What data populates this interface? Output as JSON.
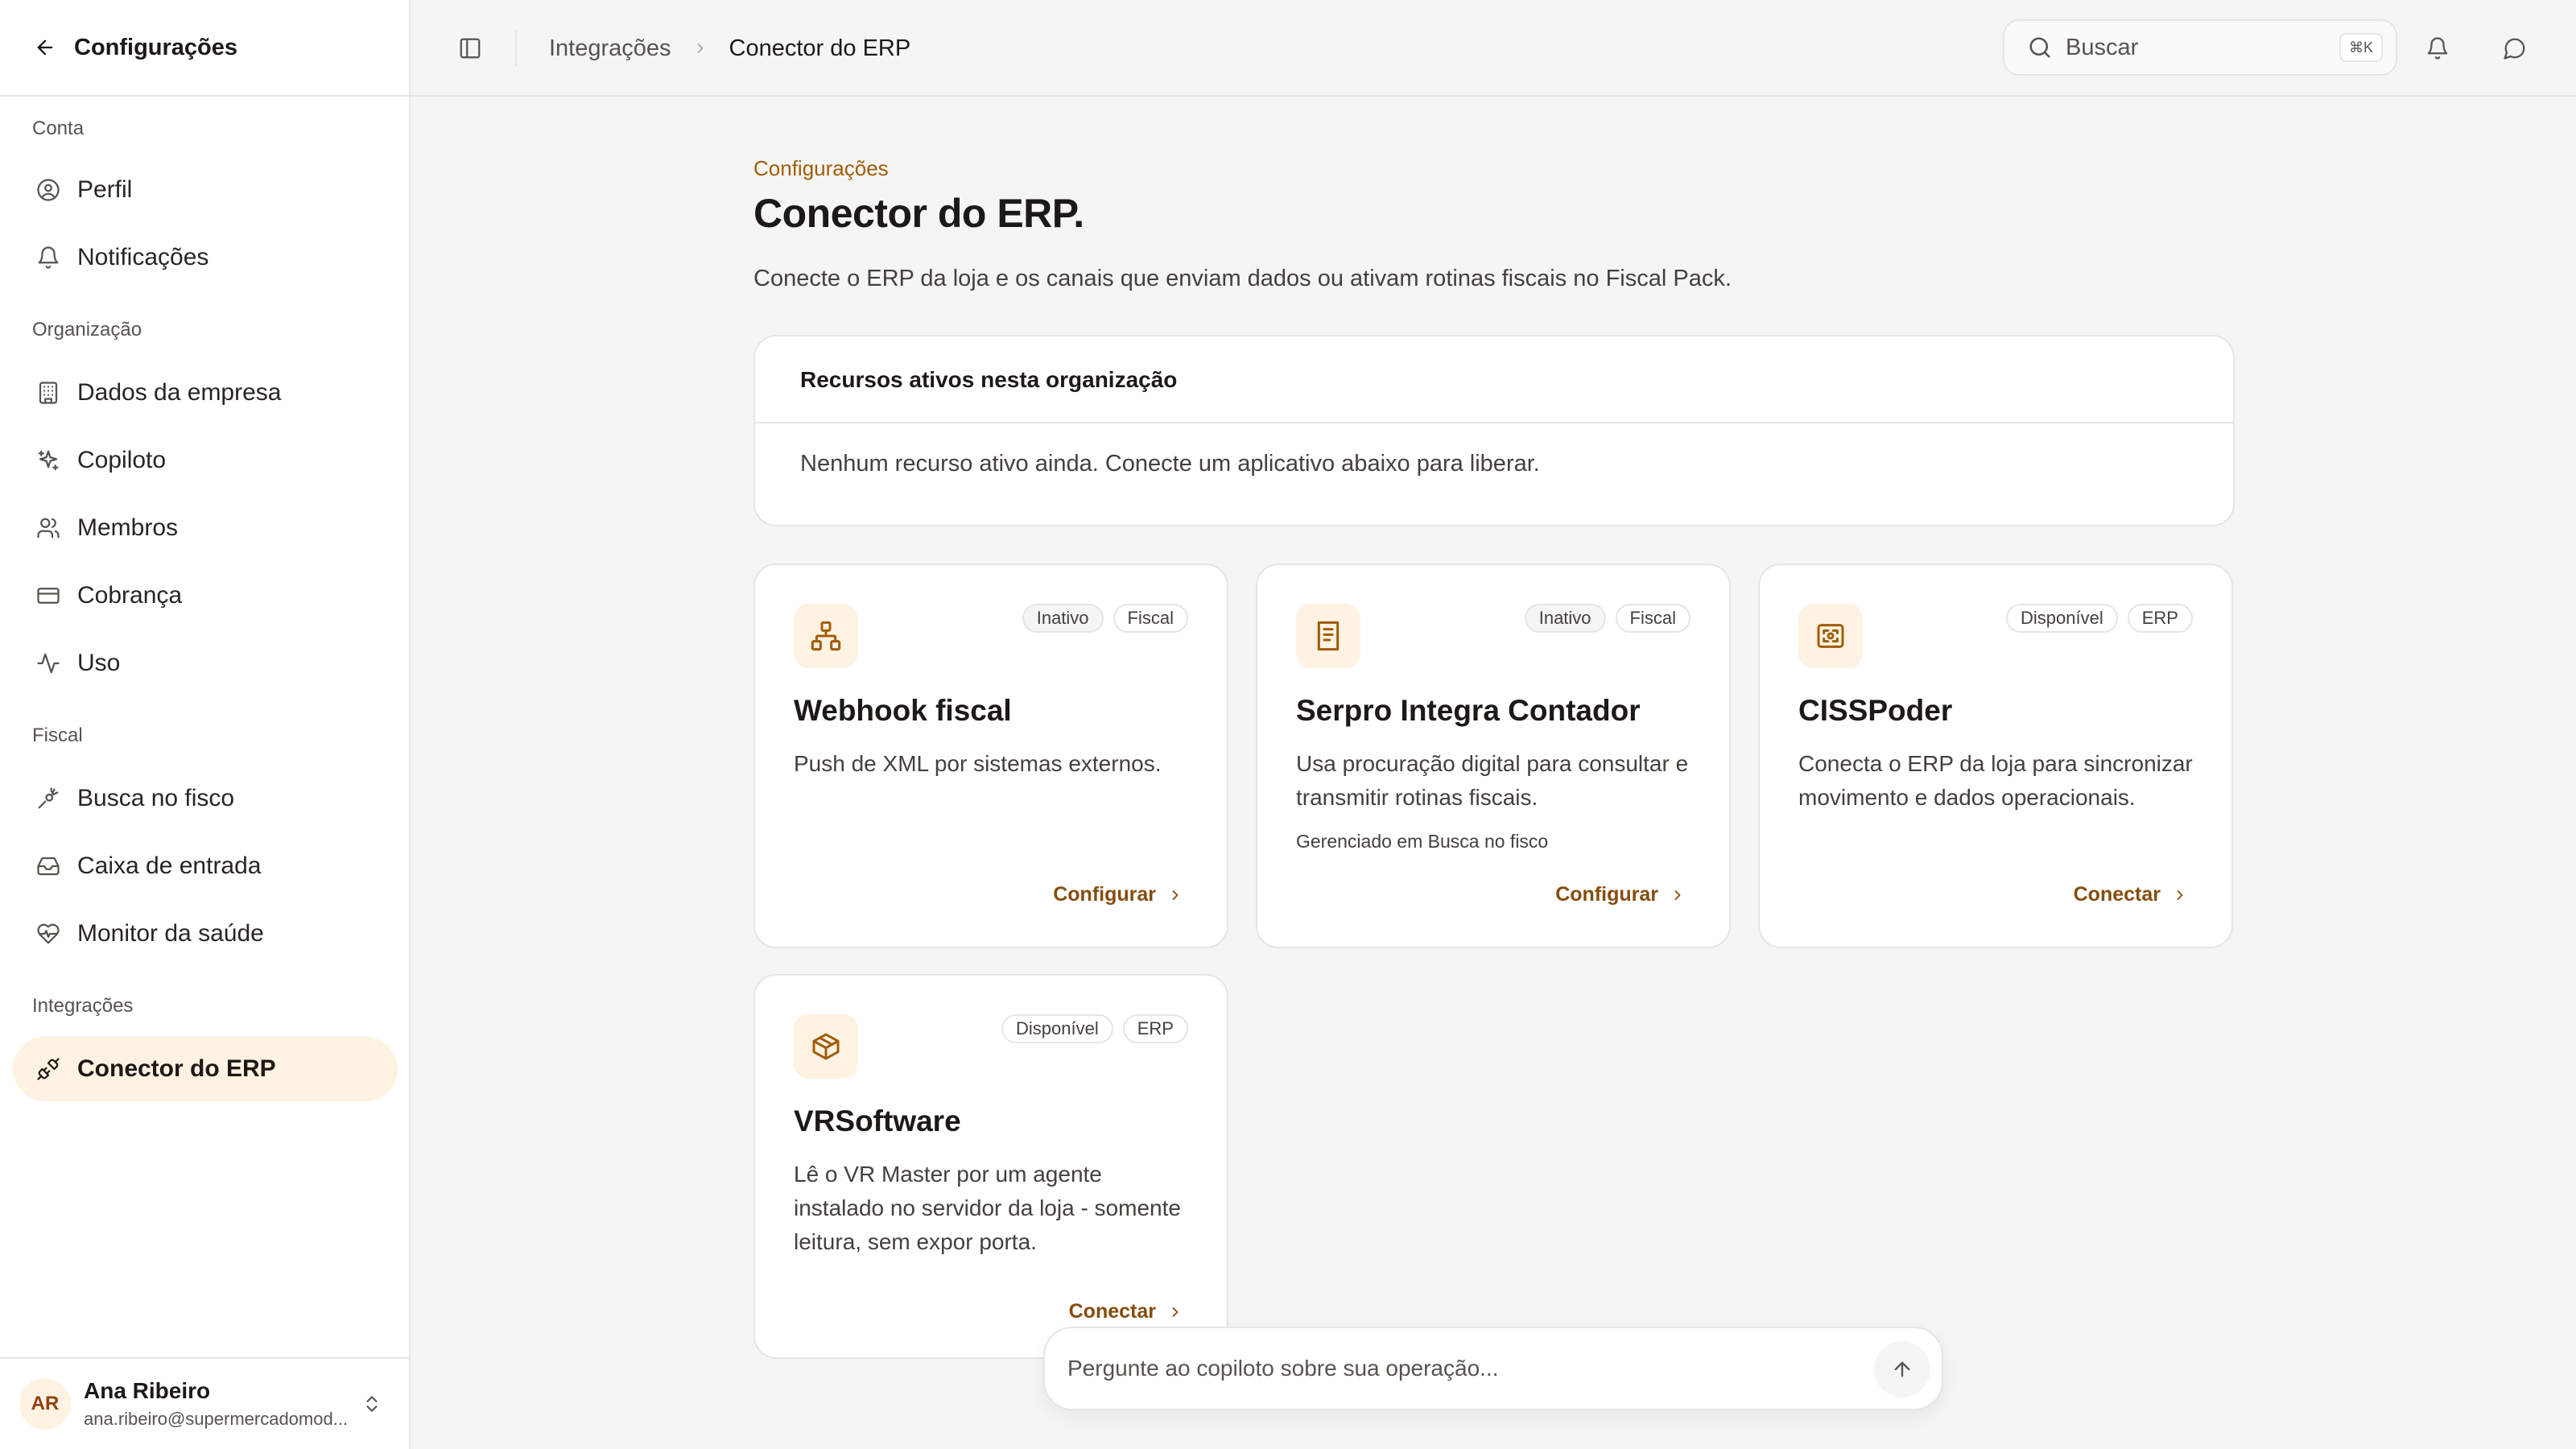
{
  "sidebar": {
    "title": "Configurações",
    "sections": [
      {
        "label": "Conta",
        "items": [
          {
            "label": "Perfil",
            "icon": "user-circle-icon"
          },
          {
            "label": "Notificações",
            "icon": "bell-icon"
          }
        ]
      },
      {
        "label": "Organização",
        "items": [
          {
            "label": "Dados da empresa",
            "icon": "building-icon"
          },
          {
            "label": "Copiloto",
            "icon": "sparkles-icon"
          },
          {
            "label": "Membros",
            "icon": "users-icon"
          },
          {
            "label": "Cobrança",
            "icon": "credit-card-icon"
          },
          {
            "label": "Uso",
            "icon": "activity-icon"
          }
        ]
      },
      {
        "label": "Fiscal",
        "items": [
          {
            "label": "Busca no fisco",
            "icon": "search-docs-icon"
          },
          {
            "label": "Caixa de entrada",
            "icon": "inbox-icon"
          },
          {
            "label": "Monitor da saúde",
            "icon": "heart-pulse-icon"
          }
        ]
      },
      {
        "label": "Integrações",
        "items": [
          {
            "label": "Conector do ERP",
            "icon": "plug-icon",
            "active": true
          }
        ]
      }
    ],
    "user": {
      "initials": "AR",
      "name": "Ana Ribeiro",
      "email": "ana.ribeiro@supermercadomod..."
    }
  },
  "topbar": {
    "breadcrumb": [
      "Integrações",
      "Conector do ERP"
    ],
    "search_label": "Buscar",
    "search_shortcut": "⌘K"
  },
  "main": {
    "eyebrow": "Configurações",
    "title": "Conector do ERP.",
    "description": "Conecte o ERP da loja e os canais que enviam dados ou ativam rotinas fiscais no Fiscal Pack.",
    "resources": {
      "title": "Recursos ativos nesta organização",
      "empty_text": "Nenhum recurso ativo ainda. Conecte um aplicativo abaixo para liberar."
    },
    "cards": [
      {
        "title": "Webhook fiscal",
        "icon": "network-icon",
        "badges": [
          "Inativo",
          "Fiscal"
        ],
        "description": "Push de XML por sistemas externos.",
        "note": "",
        "action": "Configurar"
      },
      {
        "title": "Serpro Integra Contador",
        "icon": "document-icon",
        "badges": [
          "Inativo",
          "Fiscal"
        ],
        "description": "Usa procuração digital para consultar e transmitir rotinas fiscais.",
        "note": "Gerenciado em Busca no fisco",
        "action": "Configurar"
      },
      {
        "title": "CISSPoder",
        "icon": "scan-icon",
        "badges": [
          "Disponível",
          "ERP"
        ],
        "description": "Conecta o ERP da loja para sincronizar movimento e dados operacionais.",
        "note": "",
        "action": "Conectar"
      },
      {
        "title": "VRSoftware",
        "icon": "box-icon",
        "badges": [
          "Disponível",
          "ERP"
        ],
        "description": "Lê o VR Master por um agente instalado no servidor da loja - somente leitura, sem expor porta.",
        "note": "",
        "action": "Conectar"
      }
    ]
  },
  "copilot": {
    "placeholder": "Pergunte ao copiloto sobre sua operação..."
  },
  "colors": {
    "accent": "#a15c07",
    "accent_bg": "#fef3e2",
    "background": "#f5f5f4",
    "surface": "#ffffff",
    "border": "#e7e5e4"
  }
}
